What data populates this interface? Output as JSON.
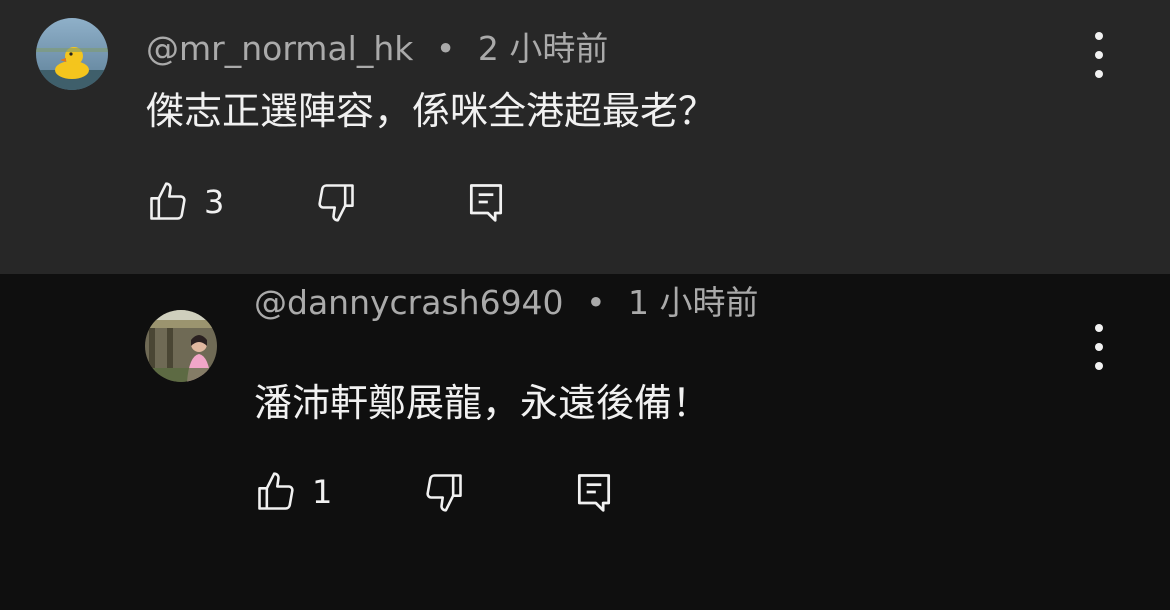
{
  "comments": [
    {
      "author": "@mr_normal_hk",
      "separator": "•",
      "time": "2 小時前",
      "text": "傑志正選陣容，係咪全港超最老？",
      "likes": "3",
      "avatar": "rubber-duck-avatar",
      "icons": [
        "thumb-up-icon",
        "thumb-down-icon",
        "reply-icon",
        "more-vert-icon"
      ]
    },
    {
      "author": "@dannycrash6940",
      "separator": "•",
      "time": "1 小時前",
      "text": "潘沛軒鄭展龍，永遠後備！",
      "likes": "1",
      "avatar": "person-photo-avatar",
      "icons": [
        "thumb-up-icon",
        "thumb-down-icon",
        "reply-icon",
        "more-vert-icon"
      ]
    }
  ],
  "colors": {
    "parent_bg": "#272727",
    "page_bg": "#0f0f0f",
    "text": "#f1f1f1",
    "meta": "#aaaaaa"
  }
}
